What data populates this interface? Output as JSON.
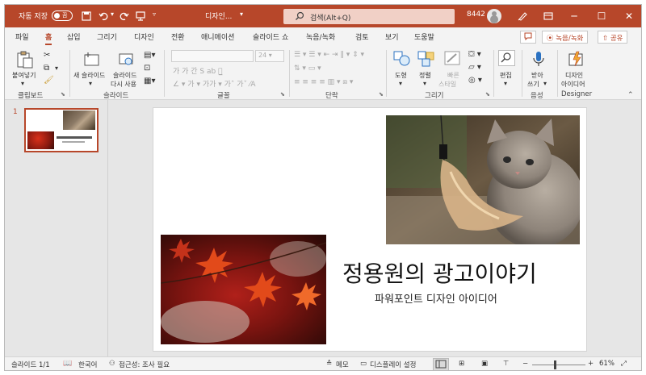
{
  "titlebar": {
    "autosave_label": "자동 저장",
    "autosave_state": "끔",
    "doc_title": "디자인...",
    "search_placeholder": "검색(Alt+Q)",
    "user_id": "8442"
  },
  "tabs": [
    "파일",
    "홈",
    "삽입",
    "그리기",
    "디자인",
    "전환",
    "애니메이션",
    "슬라이드 쇼",
    "녹음/녹화",
    "검토",
    "보기",
    "도움말"
  ],
  "tab_buttons": {
    "record": "녹음/녹화",
    "share": "공유"
  },
  "ribbon": {
    "clipboard": {
      "paste": "붙여넣기",
      "group": "클립보드"
    },
    "slides": {
      "new_slide": "새 슬라이드",
      "reuse_slide_1": "슬라이드",
      "reuse_slide_2": "다시 사용",
      "group": "슬라이드"
    },
    "font": {
      "size": "24",
      "group": "글꼴"
    },
    "paragraph": {
      "group": "단락"
    },
    "drawing": {
      "shapes": "도형",
      "arrange": "정렬",
      "quick_styles_1": "빠른",
      "quick_styles_2": "스타일",
      "group": "그리기"
    },
    "editing": {
      "edit": "편집"
    },
    "voice": {
      "dictate_1": "받아",
      "dictate_2": "쓰기",
      "group": "음성"
    },
    "designer": {
      "ideas_1": "디자인",
      "ideas_2": "아이디어",
      "group": "Designer"
    }
  },
  "thumbnail": {
    "number": "1"
  },
  "slide": {
    "title": "정용원의 광고이야기",
    "subtitle": "파워포인트 디자인 아이디어"
  },
  "status": {
    "slide_count": "슬라이드 1/1",
    "language": "한국어",
    "accessibility": "접근성: 조사 필요",
    "notes": "메모",
    "display_settings": "디스플레이 설정",
    "zoom": "61%"
  },
  "colors": {
    "accent": "#b7472a",
    "search_bg": "#f1d0c6"
  }
}
